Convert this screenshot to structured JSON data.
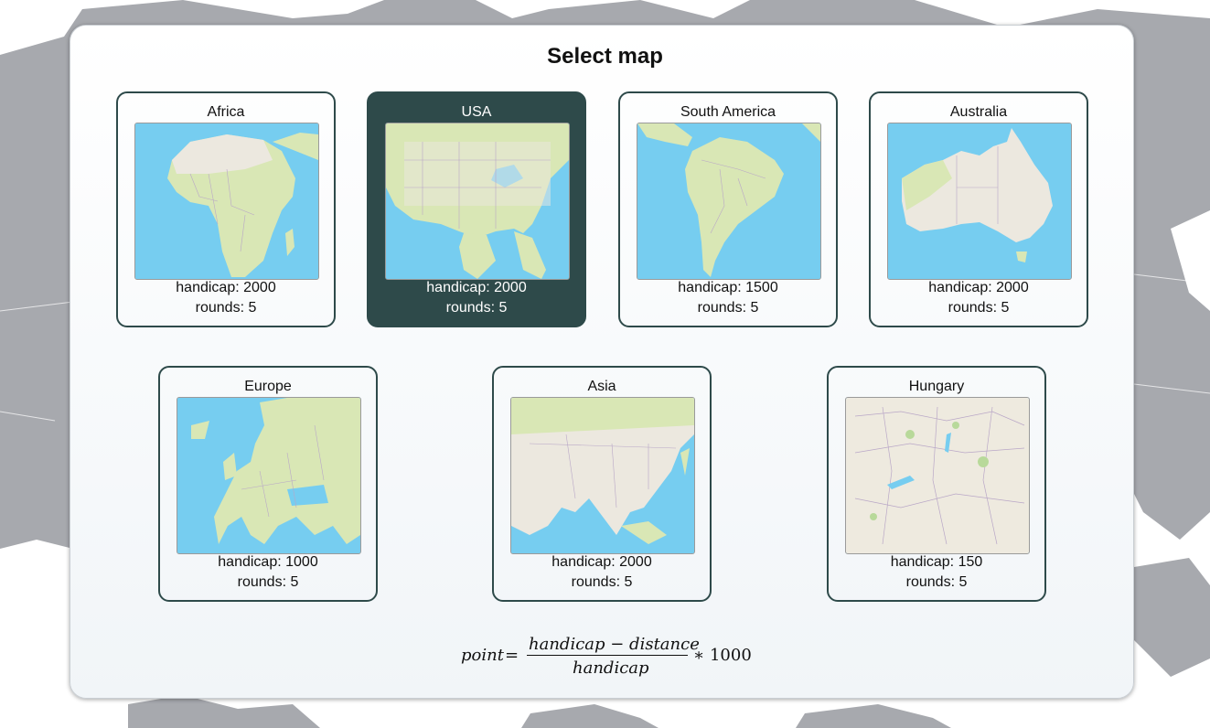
{
  "page": {
    "title": "Select map"
  },
  "maps": [
    {
      "name": "Africa",
      "handicap_text": "handicap: 2000",
      "rounds_text": "rounds: 5",
      "selected": false
    },
    {
      "name": "USA",
      "handicap_text": "handicap: 2000",
      "rounds_text": "rounds: 5",
      "selected": true
    },
    {
      "name": "South America",
      "handicap_text": "handicap: 1500",
      "rounds_text": "rounds: 5",
      "selected": false
    },
    {
      "name": "Australia",
      "handicap_text": "handicap: 2000",
      "rounds_text": "rounds: 5",
      "selected": false
    },
    {
      "name": "Europe",
      "handicap_text": "handicap: 1000",
      "rounds_text": "rounds: 5",
      "selected": false
    },
    {
      "name": "Asia",
      "handicap_text": "handicap: 2000",
      "rounds_text": "rounds: 5",
      "selected": false
    },
    {
      "name": "Hungary",
      "handicap_text": "handicap: 150",
      "rounds_text": "rounds: 5",
      "selected": false
    }
  ],
  "formula": {
    "lhs": "point",
    "equals": "=",
    "numerator": "handicap − distance",
    "denominator": "handicap",
    "multiplier": "∗ 1000"
  },
  "colors": {
    "accent": "#2e4a4a",
    "water": "#76cdf0",
    "land": "#e8e6dc",
    "background_land": "#a7a9ae"
  }
}
